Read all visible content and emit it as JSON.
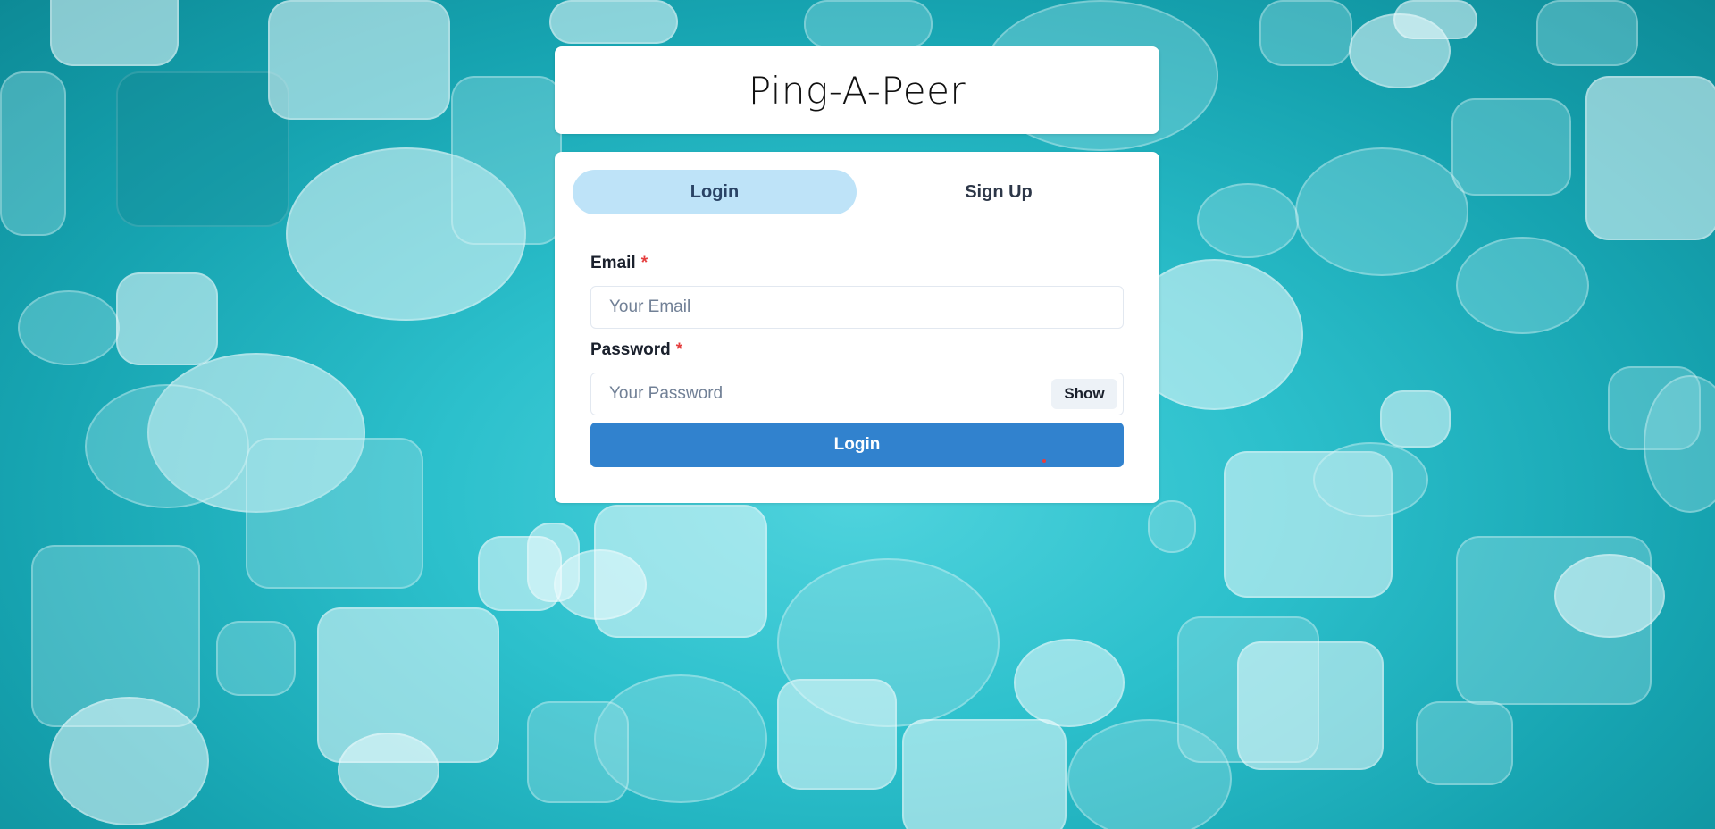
{
  "app": {
    "title": "Ping-A-Peer"
  },
  "tabs": [
    {
      "label": "Login",
      "active": true
    },
    {
      "label": "Sign Up",
      "active": false
    }
  ],
  "form": {
    "email": {
      "label": "Email",
      "required_mark": "*",
      "placeholder": "Your Email",
      "value": ""
    },
    "password": {
      "label": "Password",
      "required_mark": "*",
      "placeholder": "Your Password",
      "value": "",
      "toggle_label": "Show"
    },
    "submit_label": "Login"
  },
  "colors": {
    "background": "#2cc0cc",
    "active_tab": "#bee3f8",
    "primary_button": "#3182ce",
    "required": "#e53e3e"
  },
  "background_icon": "speech-bubbles-pattern"
}
